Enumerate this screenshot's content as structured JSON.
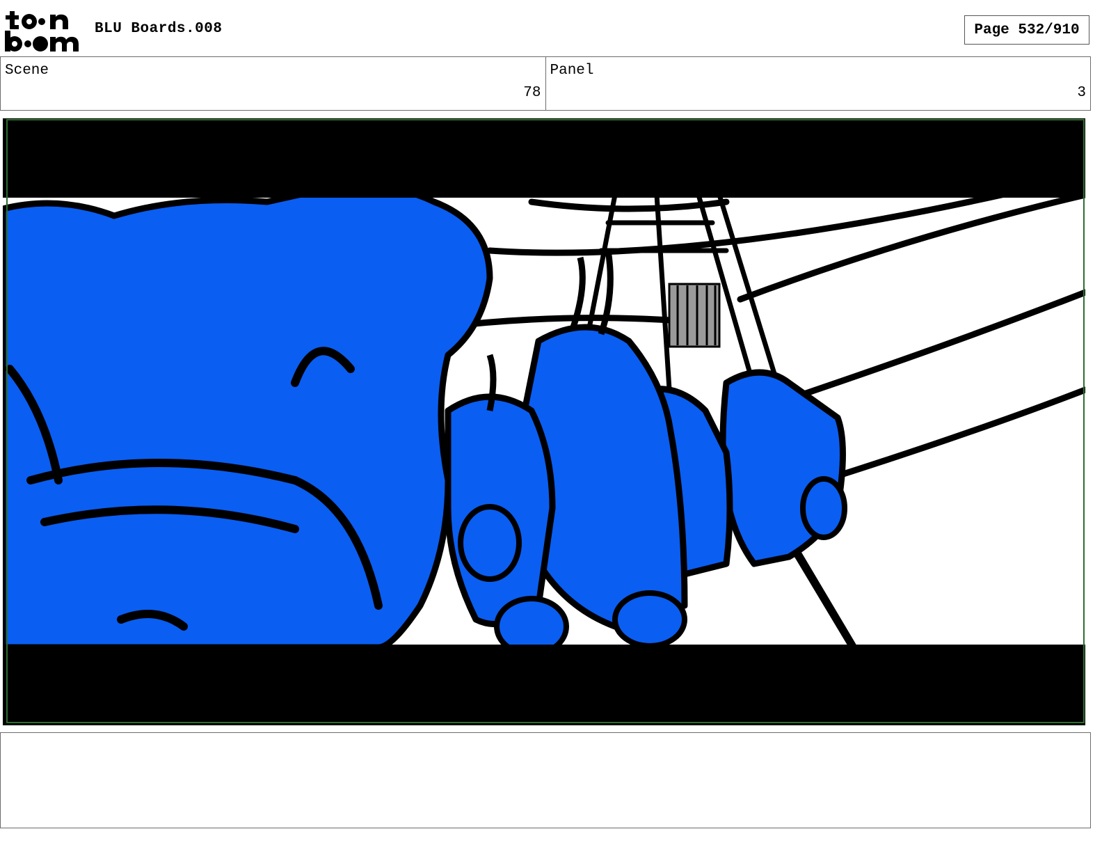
{
  "header": {
    "logo_top": "t••n",
    "logo_bottom": "b••m",
    "title": "BLU Boards.008",
    "page_indicator": "Page 532/910"
  },
  "scene": {
    "label": "Scene",
    "value": "78"
  },
  "panel": {
    "label": "Panel",
    "value": "3"
  },
  "colors": {
    "character_blue": "#0a5ef2",
    "letterbox": "#000000",
    "frame_border": "#2f6d2f"
  },
  "artwork": {
    "description_icon": "storyboard-drawing",
    "notes": ""
  }
}
